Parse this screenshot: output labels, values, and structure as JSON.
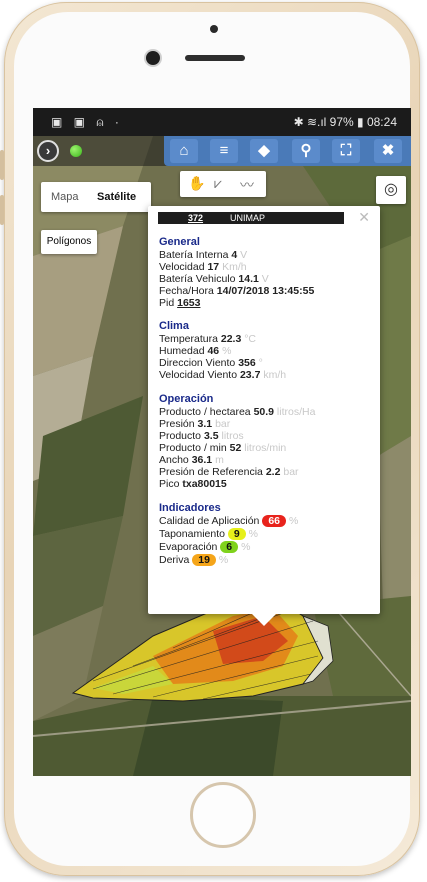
{
  "status_bar": {
    "left_icons": "▣ ▣ ⍝ ·",
    "right_text": "✱ ≋.ıl 97% ▮ 08:24"
  },
  "topbar": {
    "back_icon": "›",
    "toolbar_icons": [
      "home-icon",
      "menu-icon",
      "tag-icon",
      "pin-icon",
      "expand-icon",
      "close-icon"
    ],
    "toolbar_glyphs": [
      "⌂",
      "≡",
      "◆",
      "⚲",
      "⛶",
      "✖"
    ]
  },
  "map": {
    "type_options": [
      "Mapa",
      "Satélite"
    ],
    "selected_type": "Satélite",
    "polygons_label": "Polígonos",
    "draw_glyphs": [
      "✋",
      "⩗",
      "〰"
    ],
    "locate_glyph": "◎"
  },
  "popup": {
    "title_number": "372",
    "title_name": "UNIMAP",
    "close_glyph": "✕",
    "general": {
      "heading": "General",
      "bateria_interna": {
        "label": "Batería Interna",
        "value": "4",
        "unit": "V"
      },
      "velocidad": {
        "label": "Velocidad",
        "value": "17",
        "unit": "Km/h"
      },
      "bateria_vehiculo": {
        "label": "Batería Vehiculo",
        "value": "14.1",
        "unit": "V"
      },
      "fecha_hora": {
        "label": "Fecha/Hora",
        "value": "14/07/2018 13:45:55"
      },
      "pid": {
        "label": "Pid",
        "value": "1653"
      }
    },
    "clima": {
      "heading": "Clima",
      "temperatura": {
        "label": "Temperatura",
        "value": "22.3",
        "unit": "°C"
      },
      "humedad": {
        "label": "Humedad",
        "value": "46",
        "unit": "%"
      },
      "direccion_viento": {
        "label": "Direccion Viento",
        "value": "356",
        "unit": "°"
      },
      "velocidad_viento": {
        "label": "Velocidad Viento",
        "value": "23.7",
        "unit": "km/h"
      }
    },
    "operacion": {
      "heading": "Operación",
      "producto_hectarea": {
        "label": "Producto / hectarea",
        "value": "50.9",
        "unit": "litros/Ha"
      },
      "presion": {
        "label": "Presión",
        "value": "3.1",
        "unit": "bar"
      },
      "producto": {
        "label": "Producto",
        "value": "3.5",
        "unit": "litros"
      },
      "producto_min": {
        "label": "Producto / min",
        "value": "52",
        "unit": "litros/min"
      },
      "ancho": {
        "label": "Ancho",
        "value": "36.1",
        "unit": "m"
      },
      "presion_referencia": {
        "label": "Presión de Referencia",
        "value": "2.2",
        "unit": "bar"
      },
      "pico": {
        "label": "Pico",
        "value": "txa80015"
      }
    },
    "indicadores": {
      "heading": "Indicadores",
      "calidad": {
        "label": "Calidad de Aplicación",
        "value": "66",
        "unit": "%",
        "color": "#e8231c"
      },
      "taponamiento": {
        "label": "Taponamiento",
        "value": "9",
        "unit": "%",
        "color": "#e6f01a"
      },
      "evaporacion": {
        "label": "Evaporación",
        "value": "6",
        "unit": "%",
        "color": "#7fd21c"
      },
      "deriva": {
        "label": "Deriva",
        "value": "19",
        "unit": "%",
        "color": "#f5a51a"
      }
    }
  }
}
